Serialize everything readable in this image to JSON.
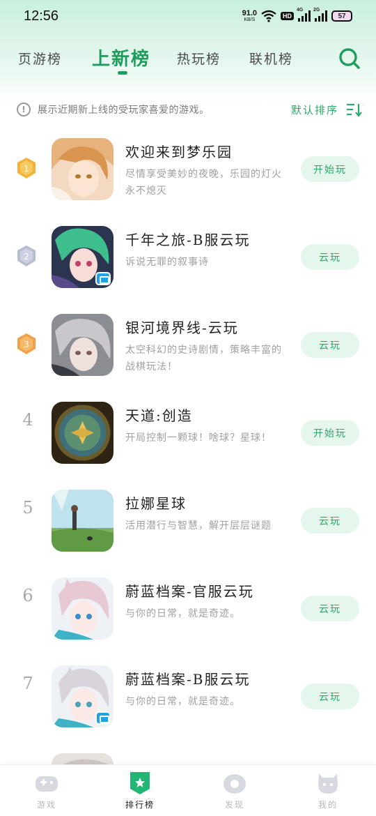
{
  "status_bar": {
    "time": "12:56",
    "net_speed_value": "91.0",
    "net_speed_unit": "KB/S",
    "hd": "HD",
    "sim1": "4G",
    "sim2": "2G",
    "battery": "57"
  },
  "tabs": [
    {
      "label": "页游榜",
      "active": false
    },
    {
      "label": "上新榜",
      "active": true
    },
    {
      "label": "热玩榜",
      "active": false
    },
    {
      "label": "联机榜",
      "active": false
    }
  ],
  "info": {
    "text": "展示近期新上线的受玩家喜爱的游戏。",
    "sort_label": "默认排序"
  },
  "games": [
    {
      "rank": "1",
      "title": "欢迎来到梦乐园",
      "desc": "尽情享受美妙的夜晚，乐园的灯火永不熄灭",
      "button": "开始玩",
      "medal": "gold",
      "cloud_tag": false
    },
    {
      "rank": "2",
      "title": "千年之旅-B服云玩",
      "desc": "诉说无罪的叙事诗",
      "button": "云玩",
      "medal": "silver",
      "cloud_tag": true
    },
    {
      "rank": "3",
      "title": "银河境界线-云玩",
      "desc": "太空科幻的史诗剧情，策略丰富的战棋玩法！",
      "button": "云玩",
      "medal": "bronze",
      "cloud_tag": false
    },
    {
      "rank": "4",
      "title": "天道:创造",
      "desc": "开局控制一颗球！啥球？星球！",
      "button": "开始玩",
      "medal": null,
      "cloud_tag": false
    },
    {
      "rank": "5",
      "title": "拉娜星球",
      "desc": "活用潜行与智慧，解开层层谜题",
      "button": "云玩",
      "medal": null,
      "cloud_tag": false
    },
    {
      "rank": "6",
      "title": "蔚蓝档案-官服云玩",
      "desc": "与你的日常，就是奇迹。",
      "button": "云玩",
      "medal": null,
      "cloud_tag": false
    },
    {
      "rank": "7",
      "title": "蔚蓝档案-B服云玩",
      "desc": "与你的日常，就是奇迹。",
      "button": "云玩",
      "medal": null,
      "cloud_tag": true
    }
  ],
  "bottom_nav": [
    {
      "label": "游戏",
      "icon": "gamepad-icon",
      "active": false
    },
    {
      "label": "排行榜",
      "icon": "ranking-icon",
      "active": true
    },
    {
      "label": "发现",
      "icon": "discover-icon",
      "active": false
    },
    {
      "label": "我的",
      "icon": "profile-icon",
      "active": false
    }
  ],
  "colors": {
    "accent": "#1e9e5e",
    "button_bg": "#e5f6ed",
    "gold": "#f2b33d",
    "silver": "#b7bdd1",
    "bronze": "#f0a14a"
  }
}
